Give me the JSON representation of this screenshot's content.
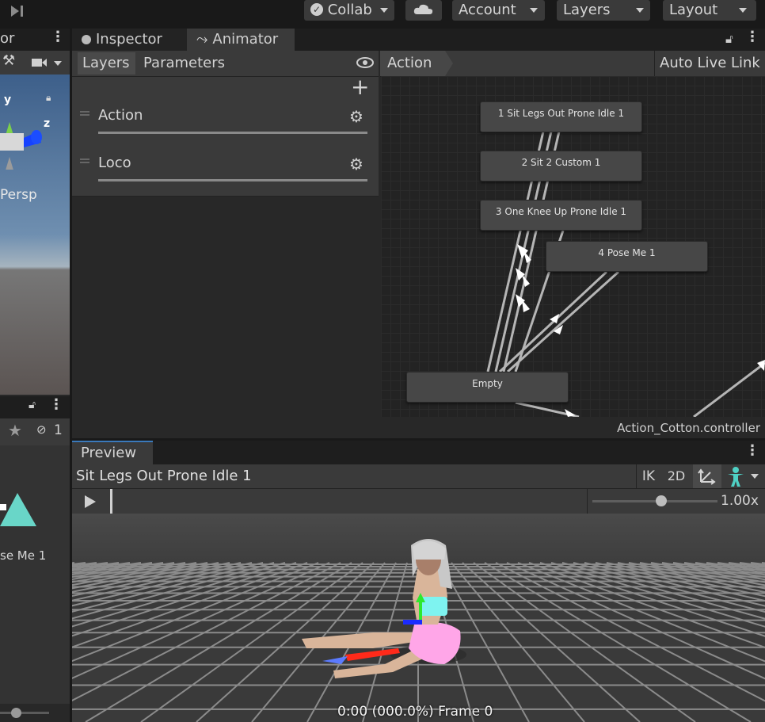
{
  "toolbar": {
    "collab_label": "Collab",
    "account_label": "Account",
    "layers_label": "Layers",
    "layout_label": "Layout"
  },
  "left_panel": {
    "tab_fragment": "or",
    "persp_label": "Persp",
    "axis_y": "y",
    "axis_z": "z",
    "hidden_count": "1",
    "asset_label": "se Me 1"
  },
  "tabs": {
    "inspector": "Inspector",
    "animator": "Animator"
  },
  "animator": {
    "layers_tab": "Layers",
    "parameters_tab": "Parameters",
    "breadcrumb": "Action",
    "auto_live_link": "Auto Live Link",
    "layers": [
      {
        "name": "Action"
      },
      {
        "name": "Loco"
      }
    ],
    "states": [
      {
        "label": "1 Sit Legs Out Prone Idle 1"
      },
      {
        "label": "2 Sit 2 Custom 1"
      },
      {
        "label": "3 One Knee Up Prone Idle 1"
      },
      {
        "label": "4 Pose Me 1"
      },
      {
        "label": "Empty"
      }
    ],
    "controller_file": "Action_Cotton.controller"
  },
  "preview": {
    "tab_label": "Preview",
    "clip_name": "Sit Legs Out Prone Idle 1",
    "ik_label": "IK",
    "twod_label": "2D",
    "speed_label": "1.00x",
    "speed_value": 0.55,
    "timecode": "0:00 (000.0%) Frame 0"
  },
  "colors": {
    "accent_blue": "#3a79bb",
    "state_node": "#474747",
    "humanoid_icon": "#4fd1c5"
  }
}
